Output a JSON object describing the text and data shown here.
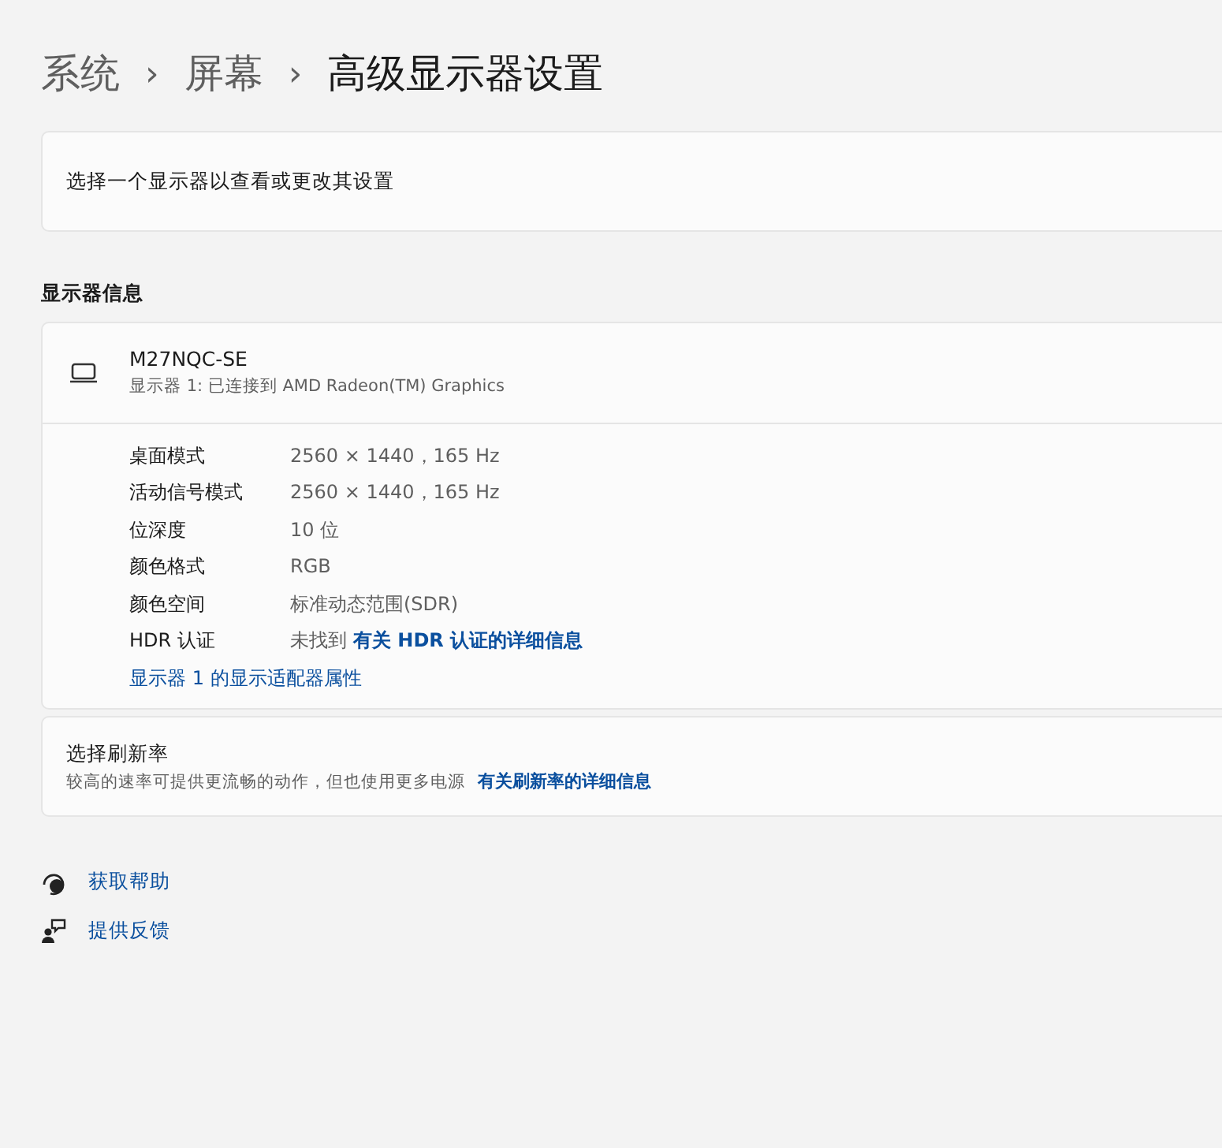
{
  "breadcrumb": [
    {
      "label": "系统",
      "current": false
    },
    {
      "label": "屏幕",
      "current": false
    },
    {
      "label": "高级显示器设置",
      "current": true
    }
  ],
  "separator": "›",
  "select_display": {
    "label": "选择一个显示器以查看或更改其设置"
  },
  "display_info": {
    "heading": "显示器信息",
    "name": "M27NQC-SE",
    "subtitle": "显示器 1: 已连接到 AMD Radeon(TM) Graphics",
    "rows": [
      {
        "label": "桌面模式",
        "value": "2560 × 1440，165 Hz"
      },
      {
        "label": "活动信号模式",
        "value": "2560 × 1440，165 Hz"
      },
      {
        "label": "位深度",
        "value": "10 位"
      },
      {
        "label": "颜色格式",
        "value": "RGB"
      },
      {
        "label": "颜色空间",
        "value": "标准动态范围(SDR)"
      },
      {
        "label": "HDR 认证",
        "value": "未找到",
        "link": "有关 HDR 认证的详细信息"
      }
    ],
    "adapter_link": "显示器 1 的显示适配器属性"
  },
  "refresh_rate": {
    "title": "选择刷新率",
    "description": "较高的速率可提供更流畅的动作，但也使用更多电源",
    "link": "有关刷新率的详细信息"
  },
  "footer_links": [
    {
      "kind": "help",
      "label": "获取帮助"
    },
    {
      "kind": "feedback",
      "label": "提供反馈"
    }
  ]
}
